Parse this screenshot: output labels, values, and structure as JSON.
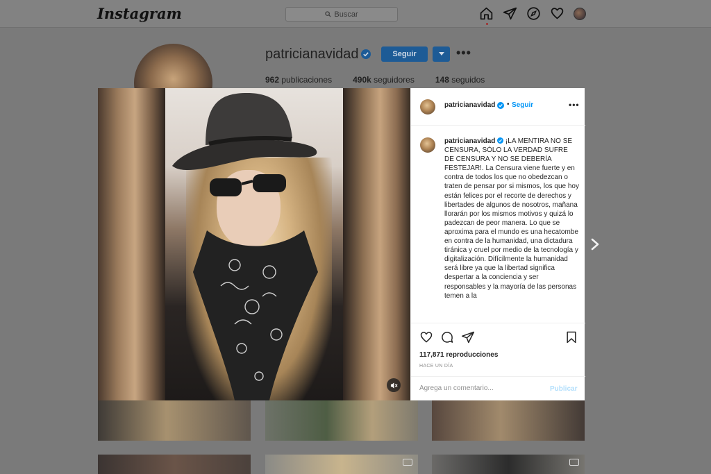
{
  "nav": {
    "logo": "Instagram",
    "search_placeholder": "Buscar",
    "icons": [
      "home-icon",
      "direct-icon",
      "explore-icon",
      "activity-heart-icon",
      "profile-avatar"
    ]
  },
  "profile": {
    "username": "patricianavidad",
    "follow_label": "Seguir",
    "stats": [
      {
        "value": "962",
        "label": "publicaciones"
      },
      {
        "value": "490k",
        "label": "seguidores"
      },
      {
        "value": "148",
        "label": "seguidos"
      }
    ]
  },
  "post": {
    "author": "patricianavidad",
    "follow_label": "Seguir",
    "dot": "•",
    "more": "•••",
    "caption_user": "patricianavidad",
    "caption_text": "¡LA MENTIRA NO SE CENSURA, SÓLO LA VERDAD SUFRE DE CENSURA Y NO SE DEBERÍA FESTEJAR!. La Censura viene fuerte y en contra de todos los que no obedezcan o traten de pensar por si mismos, los que hoy están felices por el recorte de derechos y libertades de algunos de nosotros, mañana llorarán por los mismos motivos y quizá lo padezcan de peor manera. Lo que se aproxima para el mundo es una hecatombe en contra de la humanidad, una dictadura tiránica y cruel por medio de la tecnología y digitalización. Difícilmente la humanidad será libre ya que la libertad significa despertar a la conciencia y ser responsables y la mayoría de las personas temen a la",
    "views": "117,871 reproducciones",
    "time": "HACE UN DÍA",
    "comment_placeholder": "Agrega un comentario...",
    "publish_label": "Publicar"
  },
  "colors": {
    "accent": "#0095f6",
    "overlay_bg": "#7a7a7a",
    "follow_button_dimmed": "#1d5b96"
  }
}
